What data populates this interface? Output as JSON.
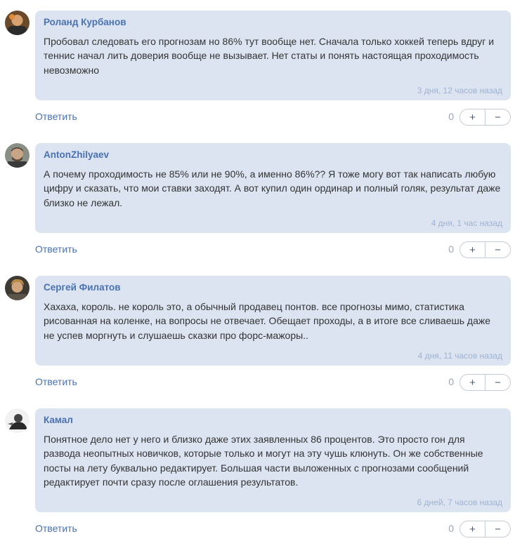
{
  "colors": {
    "bubble": "#dbe4f0",
    "author": "#4a72b2",
    "time": "#9fb3d1",
    "reply": "#4a72b2"
  },
  "comments": [
    {
      "author": "Роланд Курбанов",
      "text": "Пробовал следовать его прогнозам но 86% тут вообще нет. Сначала только хоккей теперь вдруг и теннис начал лить доверия вообще не вызывает. Нет статы и понять настоящая проходимость невозможно",
      "time": "3 дня, 12 часов назад",
      "reply": "Ответить",
      "score": "0",
      "plus": "+",
      "minus": "−",
      "avatar_icon": "user-avatar-icon"
    },
    {
      "author": "AntonZhilyaev",
      "text": "А почему проходимость не 85% или не 90%, а именно 86%?? Я тоже могу вот так написать любую цифру и сказать, что мои ставки заходят. А вот купил один ординар и полный голяк, результат даже близко не лежал.",
      "time": "4 дня, 1 час назад",
      "reply": "Ответить",
      "score": "0",
      "plus": "+",
      "minus": "−",
      "avatar_icon": "user-avatar-icon"
    },
    {
      "author": "Сергей Филатов",
      "text": "Хахаха, король. не король это, а обычный продавец понтов. все прогнозы мимо, статистика рисованная на коленке, на вопросы не отвечает. Обещает проходы, а в итоге все сливаешь даже не успев моргнуть и слушаешь сказки про форс-мажоры..",
      "time": "4 дня, 11 часов назад",
      "reply": "Ответить",
      "score": "0",
      "plus": "+",
      "minus": "−",
      "avatar_icon": "user-avatar-icon"
    },
    {
      "author": "Камал",
      "text": "Понятное дело нет у него и близко даже этих заявленных 86 процентов. Это просто гон для развода неопытных новичков, которые только и могут на эту чушь клюнуть. Он же собственные посты на лету буквально редактирует. Большая части выложенных с прогнозами сообщений редактирует почти сразу после оглашения результатов.",
      "time": "6 дней, 7 часов назад",
      "reply": "Ответить",
      "score": "0",
      "plus": "+",
      "minus": "−",
      "avatar_icon": "user-avatar-icon"
    }
  ]
}
